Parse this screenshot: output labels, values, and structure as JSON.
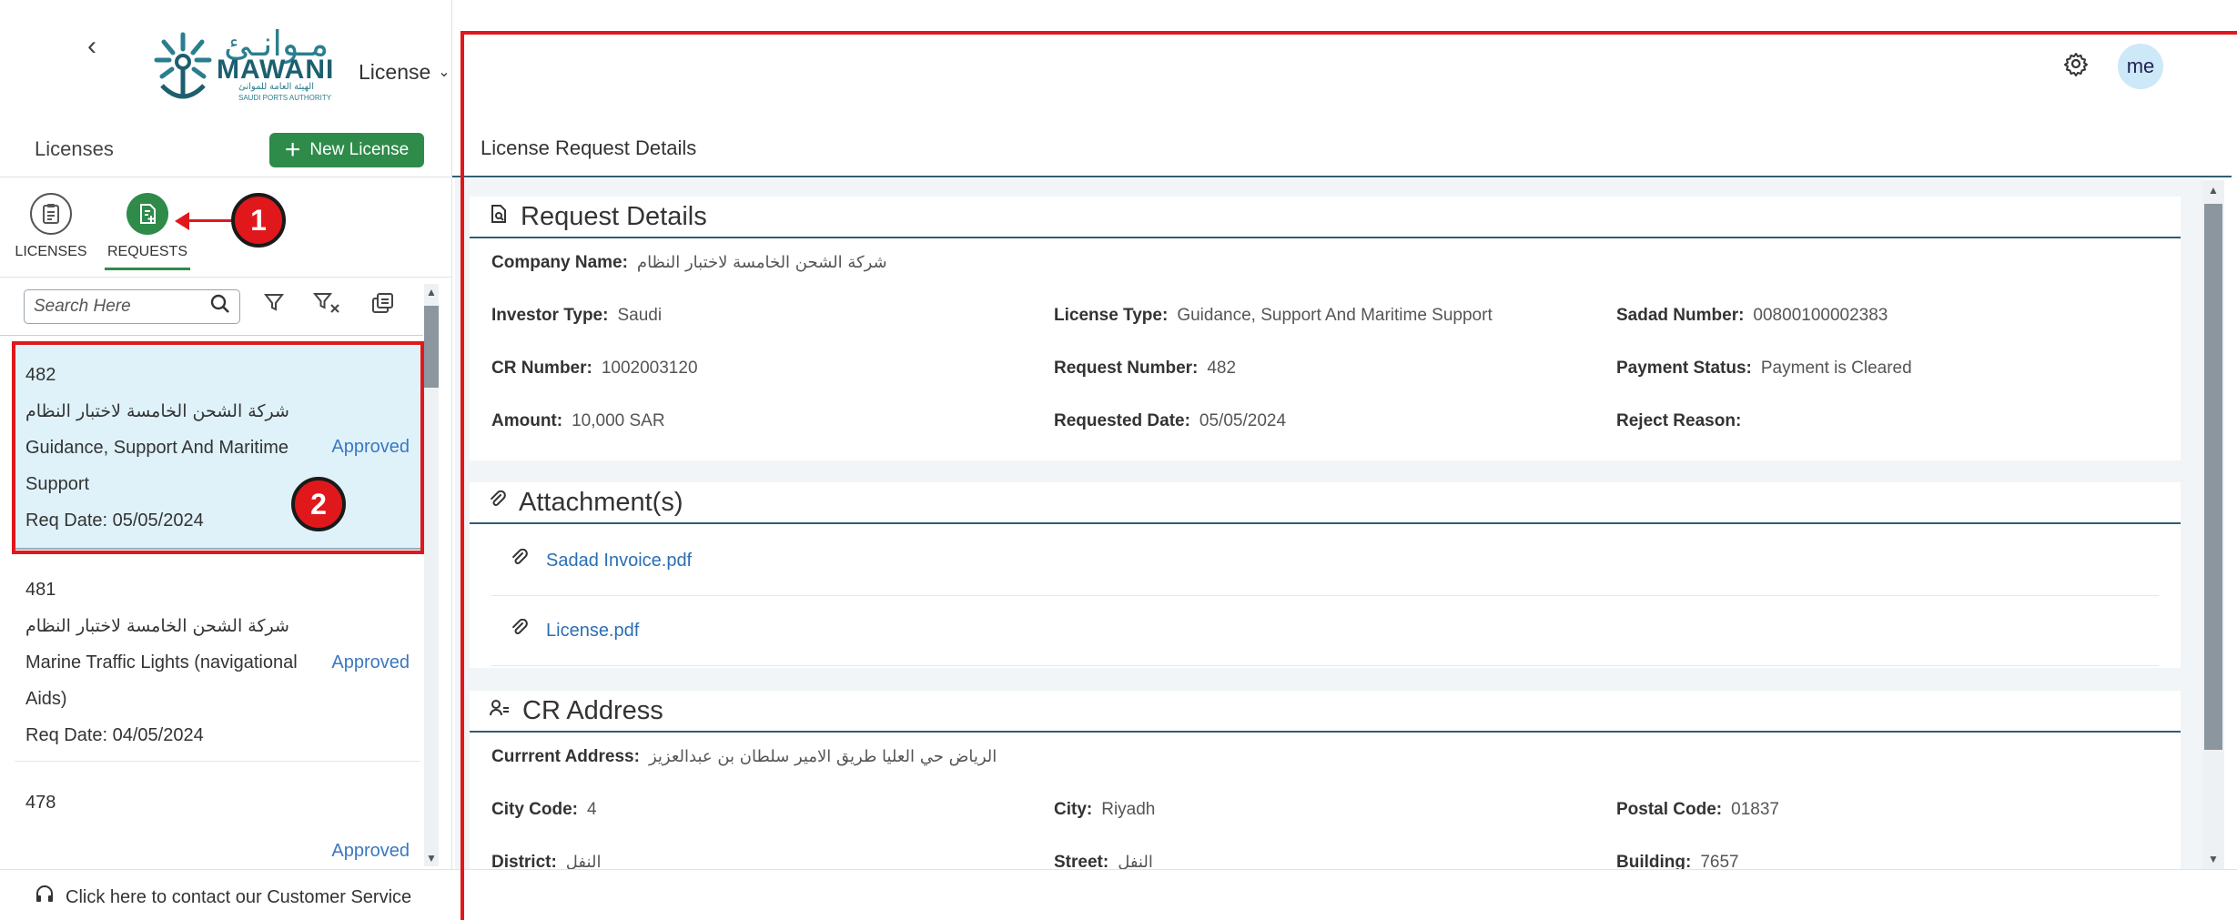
{
  "header": {
    "back_symbol": "‹",
    "logo_ar": "مـوانـئ",
    "logo_en": "MAWANI",
    "logo_sub_ar": "الهيئة العامة للموانئ",
    "logo_sub_en": "SAUDI PORTS AUTHORITY",
    "module": "License",
    "avatar": "me"
  },
  "sidebar": {
    "title": "Licenses",
    "new_button": "New License",
    "tabs": [
      {
        "label": "LICENSES"
      },
      {
        "label": "REQUESTS"
      }
    ],
    "search": {
      "placeholder": "Search Here",
      "value": ""
    },
    "requests": [
      {
        "id": "482",
        "company": "شركة الشحن الخامسة لاختبار النظام",
        "type_line1": "Guidance, Support And Maritime",
        "type_line2": "Support",
        "date": "Req Date: 05/05/2024",
        "status": "Approved"
      },
      {
        "id": "481",
        "company": "شركة الشحن الخامسة لاختبار النظام",
        "type_line1": "Marine Traffic Lights (navigational",
        "type_line2": "Aids)",
        "date": "Req Date: 04/05/2024",
        "status": "Approved"
      },
      {
        "id": "478",
        "company": "",
        "type_line1": "",
        "type_line2": "",
        "date": "",
        "status": "Approved"
      }
    ],
    "customer_service": "Click here to contact our Customer Service"
  },
  "main": {
    "page_title": "License Request Details",
    "request_details": {
      "title": "Request Details",
      "company_label": "Company Name:",
      "company_value": "شركة الشحن الخامسة لاختبار النظام",
      "investor_label": "Investor Type:",
      "investor_value": "Saudi",
      "license_type_label": "License Type:",
      "license_type_value": "Guidance, Support And Maritime Support",
      "sadad_label": "Sadad Number:",
      "sadad_value": "00800100002383",
      "cr_label": "CR Number:",
      "cr_value": "1002003120",
      "req_num_label": "Request Number:",
      "req_num_value": "482",
      "payment_label": "Payment Status:",
      "payment_value": "Payment is Cleared",
      "amount_label": "Amount:",
      "amount_value": "10,000 SAR",
      "req_date_label": "Requested Date:",
      "req_date_value": "05/05/2024",
      "reject_label": "Reject Reason:",
      "reject_value": ""
    },
    "attachments": {
      "title": "Attachment(s)",
      "files": [
        "Sadad Invoice.pdf",
        "License.pdf"
      ]
    },
    "cr_address": {
      "title": "CR Address",
      "address_label": "Currrent Address:",
      "address_value": "الرياض حي العليا طريق الامير سلطان بن عبدالعزيز",
      "city_code_label": "City Code:",
      "city_code_value": "4",
      "city_label": "City:",
      "city_value": "Riyadh",
      "postal_label": "Postal Code:",
      "postal_value": "01837",
      "district_label": "District:",
      "district_value": "النفل",
      "street_label": "Street:",
      "street_value": "النفل",
      "building_label": "Building:",
      "building_value": "7657"
    }
  },
  "annotations": {
    "badge1": "1",
    "badge2": "2"
  },
  "colors": {
    "accent_green": "#2e8b4a",
    "annotation_red": "#e0181c",
    "link_blue": "#2a6fb5",
    "status_blue": "#3a78c2",
    "selected_bg": "#dff2fa"
  }
}
